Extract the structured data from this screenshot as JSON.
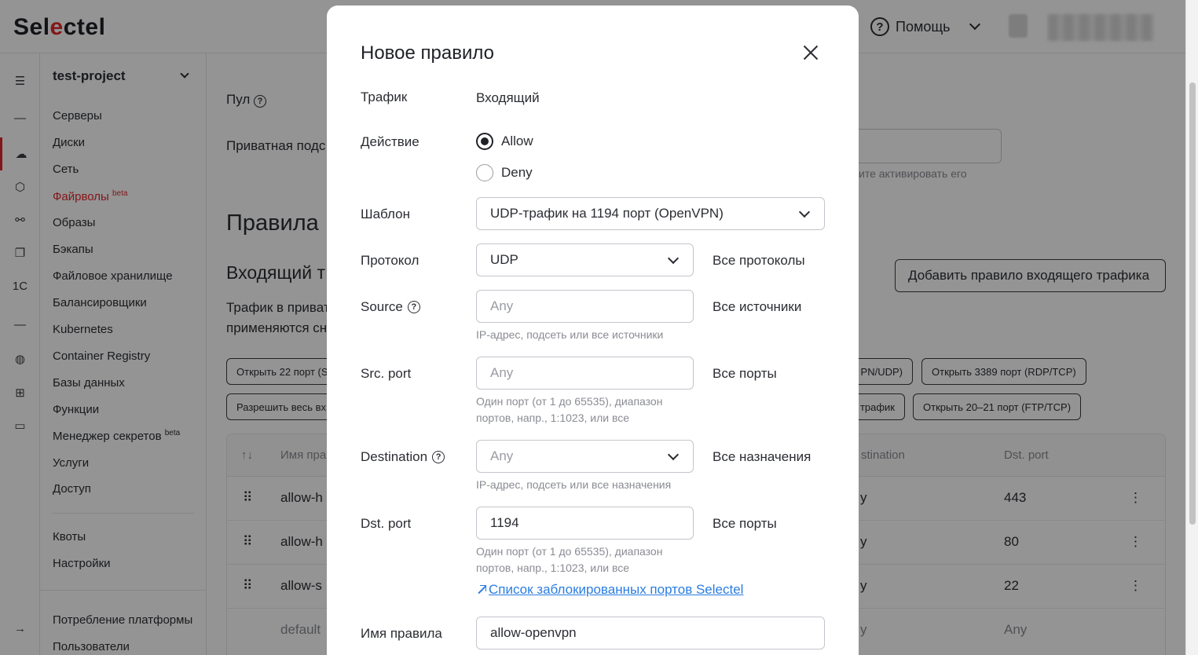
{
  "app": {
    "logo": "Selectel",
    "help_label": "Помощь"
  },
  "sidebar": {
    "project": "test-project",
    "items": [
      {
        "label": "Серверы"
      },
      {
        "label": "Диски"
      },
      {
        "label": "Сеть"
      },
      {
        "label": "Файрволы",
        "badge": "beta"
      },
      {
        "label": "Образы"
      },
      {
        "label": "Бэкапы"
      },
      {
        "label": "Файловое хранилище"
      },
      {
        "label": "Балансировщики"
      },
      {
        "label": "Kubernetes"
      },
      {
        "label": "Container Registry"
      },
      {
        "label": "Базы данных"
      },
      {
        "label": "Функции"
      },
      {
        "label": "Менеджер секретов",
        "badge": "beta"
      },
      {
        "label": "Услуги"
      },
      {
        "label": "Доступ"
      }
    ],
    "items2": [
      {
        "label": "Квоты"
      },
      {
        "label": "Настройки"
      }
    ],
    "items3": [
      {
        "label": "Потребление платформы"
      },
      {
        "label": "Пользователи"
      }
    ],
    "rail_1c": "1C"
  },
  "main": {
    "pool_label": "Пул",
    "private_subnet_label": "Приватная подс",
    "activate_hint": "ите активировать его",
    "rules_title": "Правила",
    "incoming_title": "Входящий т",
    "incoming_desc_1": "Трафик в приват",
    "incoming_desc_2": "применяются сн",
    "add_rule_button": "Добавить правило входящего трафика",
    "chips": [
      "Открыть 22 порт (S",
      "PN/UDP)",
      "Открыть 3389 порт (RDP/TCP)",
      "Разрешить весь вх",
      "трафик",
      "Открыть 20–21 порт (FTP/TCP)"
    ],
    "table": {
      "headers": {
        "sort": "↑↓",
        "name": "Имя пра",
        "destination": "stination",
        "dst_port": "Dst. port"
      },
      "rows": [
        {
          "name": "allow-h",
          "destination": "y",
          "dst_port": "443"
        },
        {
          "name": "allow-h",
          "destination": "y",
          "dst_port": "80"
        },
        {
          "name": "allow-s",
          "destination": "y",
          "dst_port": "22"
        },
        {
          "name": "default",
          "destination": "y",
          "dst_port": "Any"
        }
      ]
    }
  },
  "modal": {
    "title": "Новое правило",
    "traffic_label": "Трафик",
    "traffic_value": "Входящий",
    "action_label": "Действие",
    "action_options": [
      {
        "label": "Allow",
        "selected": true
      },
      {
        "label": "Deny",
        "selected": false
      }
    ],
    "template_label": "Шаблон",
    "template_value": "UDP-трафик на 1194 порт (OpenVPN)",
    "protocol_label": "Протокол",
    "protocol_value": "UDP",
    "protocol_all": "Все протоколы",
    "source_label": "Source",
    "source_placeholder": "Any",
    "source_all": "Все источники",
    "source_hint": "IP-адрес, подсеть или все источники",
    "src_port_label": "Src. port",
    "src_port_placeholder": "Any",
    "src_port_all": "Все порты",
    "src_port_hint_1": "Один порт (от 1 до 65535), диапазон",
    "src_port_hint_2": "портов, напр., 1:1023, или все",
    "destination_label": "Destination",
    "destination_value": "Any",
    "destination_all": "Все назначения",
    "destination_hint": "IP-адрес, подсеть или все назначения",
    "dst_port_label": "Dst. port",
    "dst_port_value": "1194",
    "dst_port_all": "Все порты",
    "dst_port_hint_1": "Один порт (от 1 до 65535), диапазон",
    "dst_port_hint_2": "портов, напр., 1:1023, или все",
    "blocked_ports_link": "Список заблокированных портов Selectel",
    "rule_name_label": "Имя правила",
    "rule_name_value": "allow-openvpn"
  },
  "colors": {
    "accent_red": "#e3272c",
    "link_blue": "#2a7de1"
  }
}
